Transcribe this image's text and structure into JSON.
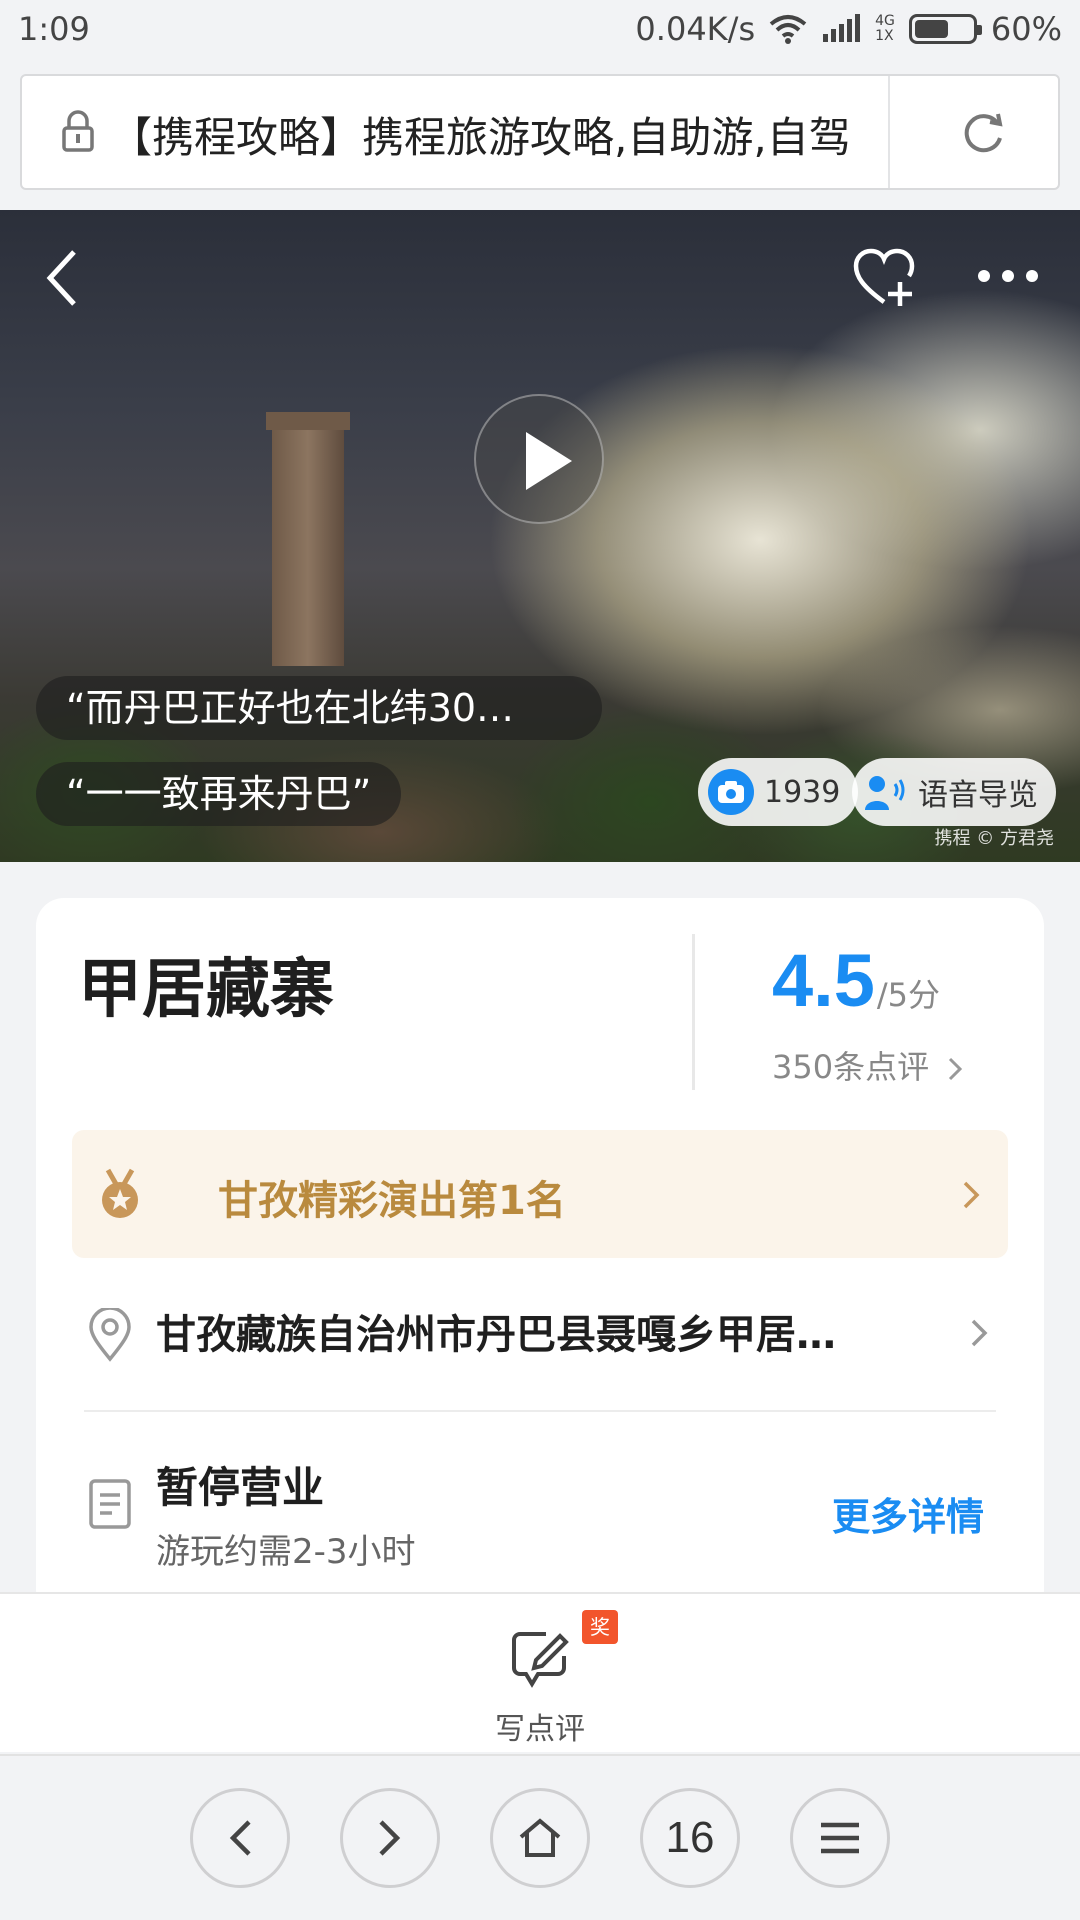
{
  "status_bar": {
    "time": "1:09",
    "net_speed": "0.04K/s",
    "net_type_top": "4G",
    "net_type_bottom": "1X",
    "battery": "60%",
    "battery_level": 0.6
  },
  "browser": {
    "url_title": "【携程攻略】携程旅游攻略,自助游,自驾",
    "tab_count": "16"
  },
  "hero": {
    "quote_1": "“而丹巴正好也在北纬30…",
    "quote_2": "“一一致再来丹巴”",
    "photo_count": "1939",
    "audio_guide": "语音导览",
    "watermark": "携程 © 方君尧"
  },
  "poi": {
    "name": "甲居藏寨",
    "score": "4.5",
    "score_max": "/5分",
    "review_count": "350条点评",
    "ranking": "甘孜精彩演出第1名",
    "address": "甘孜藏族自治州市丹巴县聂嘎乡甲居…",
    "status": "暂停营业",
    "duration": "游玩约需2-3小时",
    "more_details": "更多详情"
  },
  "review_bar": {
    "label": "写点评",
    "badge": "奖"
  },
  "colors": {
    "accent_blue": "#1a8cf2",
    "ranking_gold": "#b98a3e",
    "badge_red": "#f2552c"
  },
  "icons": [
    "lock-icon",
    "refresh-icon",
    "back-arrow-icon",
    "favorite-add-icon",
    "more-icon",
    "play-icon",
    "camera-icon",
    "audio-guide-icon",
    "medal-icon",
    "location-pin-icon",
    "document-icon",
    "edit-review-icon",
    "chevron-left-icon",
    "chevron-right-icon",
    "home-icon",
    "menu-icon"
  ]
}
